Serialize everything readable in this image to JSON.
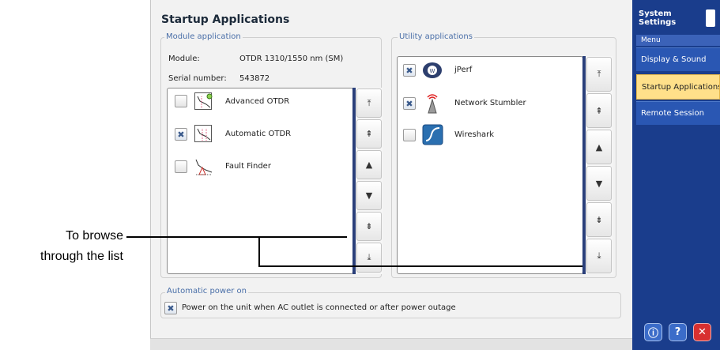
{
  "dialog": {
    "title": "Startup Applications",
    "module_group": {
      "legend": "Module application",
      "module_label": "Module:",
      "module_value": "OTDR 1310/1550 nm (SM)",
      "serial_label": "Serial number:",
      "serial_value": "543872",
      "items": [
        {
          "label": "Advanced OTDR",
          "checked": false,
          "icon": "advanced-otdr-icon"
        },
        {
          "label": "Automatic OTDR",
          "checked": true,
          "icon": "automatic-otdr-icon"
        },
        {
          "label": "Fault Finder",
          "checked": false,
          "icon": "fault-finder-icon"
        }
      ],
      "scroll_buttons": [
        "⤒",
        "⇞",
        "▲",
        "▼",
        "⇟",
        "⤓"
      ]
    },
    "utility_group": {
      "legend": "Utility applications",
      "items": [
        {
          "label": "jPerf",
          "checked": true,
          "icon": "jperf-icon"
        },
        {
          "label": "Network Stumbler",
          "checked": true,
          "icon": "network-stumbler-icon"
        },
        {
          "label": "Wireshark",
          "checked": false,
          "icon": "wireshark-icon"
        }
      ],
      "scroll_buttons": [
        "⤒",
        "⇞",
        "▲",
        "▼",
        "⇟",
        "⤓"
      ]
    },
    "power_group": {
      "legend": "Automatic power on",
      "checked": true,
      "label": "Power on the unit when AC outlet is connected or after power outage"
    }
  },
  "sidebar": {
    "title_line1": "System",
    "title_line2": "Settings",
    "menu_header": "Menu",
    "items": [
      "Display & Sound",
      "Startup Applications",
      "Remote Session"
    ],
    "active_index": 1,
    "bottom_buttons": {
      "info": "ⓘ",
      "help": "?",
      "close": "✕"
    }
  },
  "annotation": {
    "line1": "To browse",
    "line2": "through the list"
  },
  "check_mark": "✖"
}
